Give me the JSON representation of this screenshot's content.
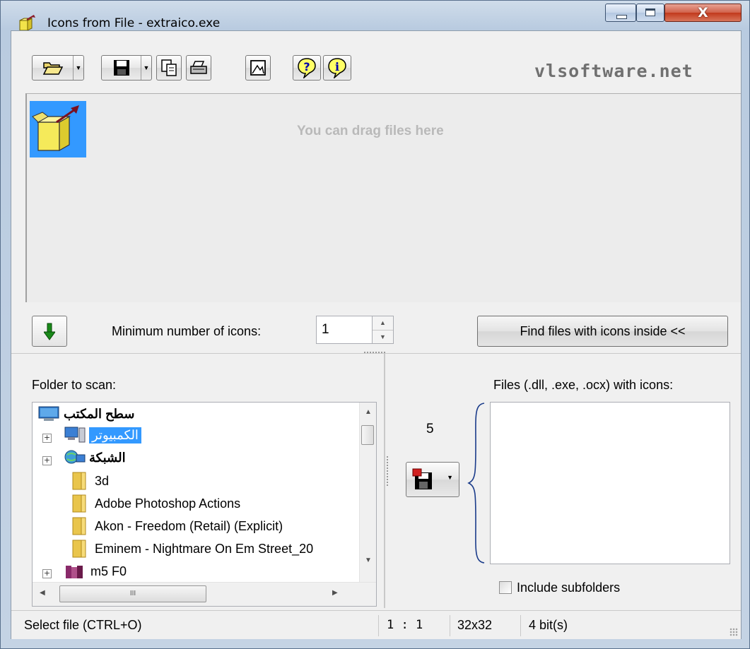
{
  "window": {
    "title": "Icons from File - extraico.exe",
    "close_glyph": "X"
  },
  "toolbar": {
    "buttons": [
      "open-folder-icon",
      "save-disk-icon",
      "copy-icon",
      "print-icon",
      "image-view-icon",
      "help-icon",
      "about-info-icon"
    ],
    "brand": "vlsoftware.net"
  },
  "icon_area": {
    "hint": "You can drag files here",
    "selected_icon": "extraico-box-icon",
    "selection_color": "#3399ff"
  },
  "controls": {
    "min_icons_label": "Minimum number of icons:",
    "min_icons_value": "1",
    "find_button": "Find files with icons inside <<"
  },
  "folder_pane": {
    "label": "Folder to scan:",
    "tree": [
      {
        "label": "سطح المكتب",
        "icon": "desktop-icon",
        "level": 0,
        "expandable": false,
        "bold": true
      },
      {
        "label": "الكمبيوتر",
        "icon": "computer-icon",
        "level": 1,
        "expandable": true,
        "selected": true
      },
      {
        "label": "الشبكة",
        "icon": "network-icon",
        "level": 1,
        "expandable": true,
        "bold": true
      },
      {
        "label": "3d",
        "icon": "folder-icon",
        "level": 1,
        "expandable": false
      },
      {
        "label": "Adobe Photoshop Actions",
        "icon": "folder-icon",
        "level": 1,
        "expandable": false
      },
      {
        "label": "Akon - Freedom (Retail) (Explicit)",
        "icon": "folder-icon",
        "level": 1,
        "expandable": false
      },
      {
        "label": "Eminem - Nightmare On Em Street_20",
        "icon": "folder-icon",
        "level": 1,
        "expandable": false
      },
      {
        "label": "m5 F0",
        "icon": "books-icon",
        "level": 1,
        "expandable": true
      }
    ],
    "hscroll_grip": "III"
  },
  "files_pane": {
    "count": "5",
    "label": "Files (.dll, .exe, .ocx) with icons:",
    "include_subfolders_label": "Include subfolders",
    "include_subfolders_checked": false
  },
  "statusbar": {
    "hint": "Select file (CTRL+O)",
    "zoom": "1 : 1",
    "size": "32x32",
    "depth": "4 bit(s)"
  }
}
